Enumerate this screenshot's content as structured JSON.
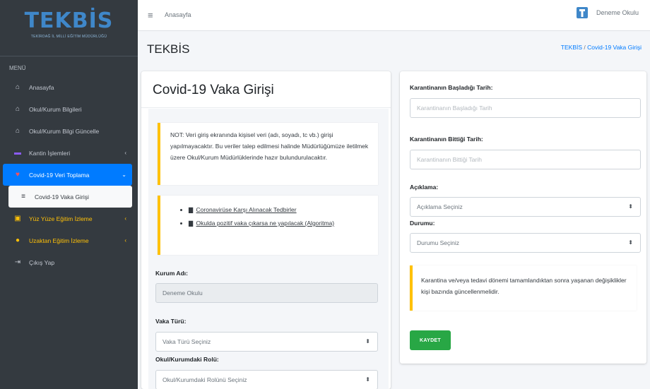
{
  "sidebar": {
    "brand": "TEKBİS",
    "brand_subtitle": "TEKİRDAĞ İL MİLLİ EĞİTİM MÜDÜRLÜĞÜ",
    "menu_header": "MENÜ",
    "items": [
      {
        "label": "Anasayfa",
        "icon": "home-icon"
      },
      {
        "label": "Okul/Kurum Bilgileri",
        "icon": "institution-icon"
      },
      {
        "label": "Okul/Kurum Bilgi Güncelle",
        "icon": "institution-icon"
      },
      {
        "label": "Kantin İşlemleri",
        "icon": "cart-icon"
      },
      {
        "label": "Covid-19 Veri Toplama",
        "icon": "heart-icon"
      },
      {
        "label": "Covid-19 Vaka Girişi",
        "icon": "database-icon"
      },
      {
        "label": "Yüz Yüze Eğitim İzleme",
        "icon": "classroom-icon"
      },
      {
        "label": "Uzaktan Eğitim İzleme",
        "icon": "users-icon"
      },
      {
        "label": "Çıkış Yap",
        "icon": "logout-icon"
      }
    ]
  },
  "topbar": {
    "home_link": "Anasayfa",
    "user_name": "Deneme Okulu"
  },
  "content": {
    "title": "TEKBİS",
    "breadcrumb": {
      "home": "TEKBİS",
      "separator": "/",
      "current": "Covid-19 Vaka Girişi"
    }
  },
  "form": {
    "title": "Covid-19 Vaka Girişi",
    "note": "NOT: Veri giriş ekranında kişisel veri (adı, soyadı, tc vb.) girişi yapılmayacaktır. Bu veriler talep edilmesi halinde Müdürlüğümüze iletilmek üzere Okul/Kurum Müdürlüklerinde hazır bulundurulacaktır.",
    "links": [
      "Coronavirüse Karşı Alınacak Tedbirler",
      "Okulda pozitif vaka çıkarsa ne yapılacak (Algoritma)"
    ],
    "kurum_adi_label": "Kurum Adı:",
    "kurum_adi_value": "Deneme Okulu",
    "vaka_turu_label": "Vaka Türü:",
    "vaka_turu_value": "Vaka Türü Seçiniz",
    "okul_rol_label": "Okul/Kurumdaki Rolü:",
    "okul_rol_value": "Okul/Kurumdaki Rolünü Seçiniz",
    "karantina_baslangic_label": "Karantinanın Başladığı Tarih:",
    "karantina_baslangic_placeholder": "Karantinanın Başladığı Tarih",
    "karantina_bitis_label": "Karantinanın Bittiği Tarih:",
    "karantina_bitis_placeholder": "Karantinanın Bittiği Tarih",
    "aciklama_label": "Açıklama:",
    "aciklama_value": "Açıklama Seçiniz",
    "durumu_label": "Durumu:",
    "durumu_value": "Durumu Seçiniz",
    "info_note": "Karantina ve/veya tedavi dönemi tamamlandıktan sonra yaşanan değişiklikler kişi bazında güncellenmelidir.",
    "save_label": "KAYDET"
  },
  "colors": {
    "sidebar_bg": "#343a40",
    "accent": "#007bff",
    "warning": "#ffc107",
    "success": "#28a745"
  }
}
